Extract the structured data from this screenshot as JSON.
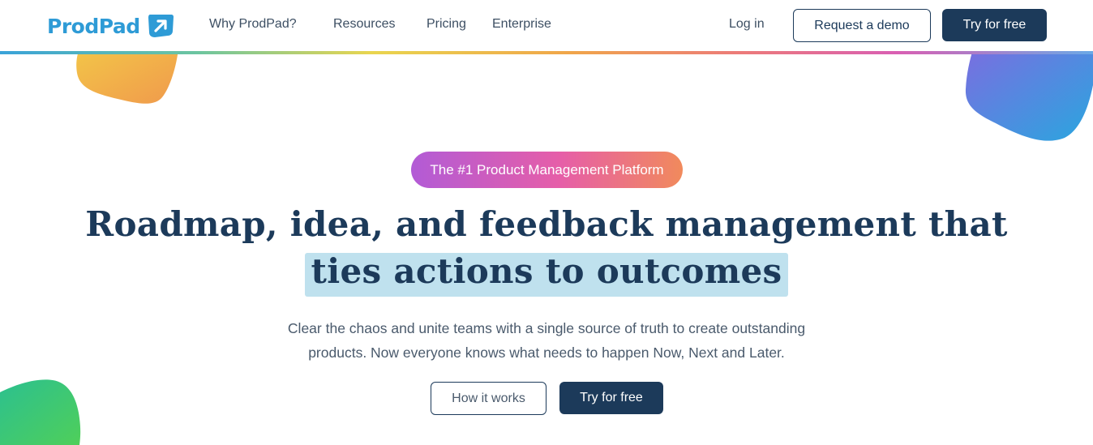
{
  "header": {
    "logo_text": "ProdPad",
    "logo_icon": "arrow-up-right-icon",
    "nav": [
      "Why ProdPad?",
      "Resources",
      "Pricing",
      "Enterprise"
    ],
    "login_label": "Log in",
    "demo_label": "Request a demo",
    "try_label": "Try for free"
  },
  "hero": {
    "badge": "The #1 Product Management Platform",
    "headline_line1": "Roadmap, idea, and feedback management that",
    "headline_line2": "ties actions to outcomes",
    "subtext": "Clear the chaos and unite teams with a single source of truth to create outstanding products. Now everyone knows what needs to happen Now, Next and Later.",
    "how_label": "How it works",
    "try_label": "Try for free"
  },
  "colors": {
    "brand_blue": "#2e9bd6",
    "navy": "#1c3a5a",
    "highlight": "#bfe1ee"
  }
}
